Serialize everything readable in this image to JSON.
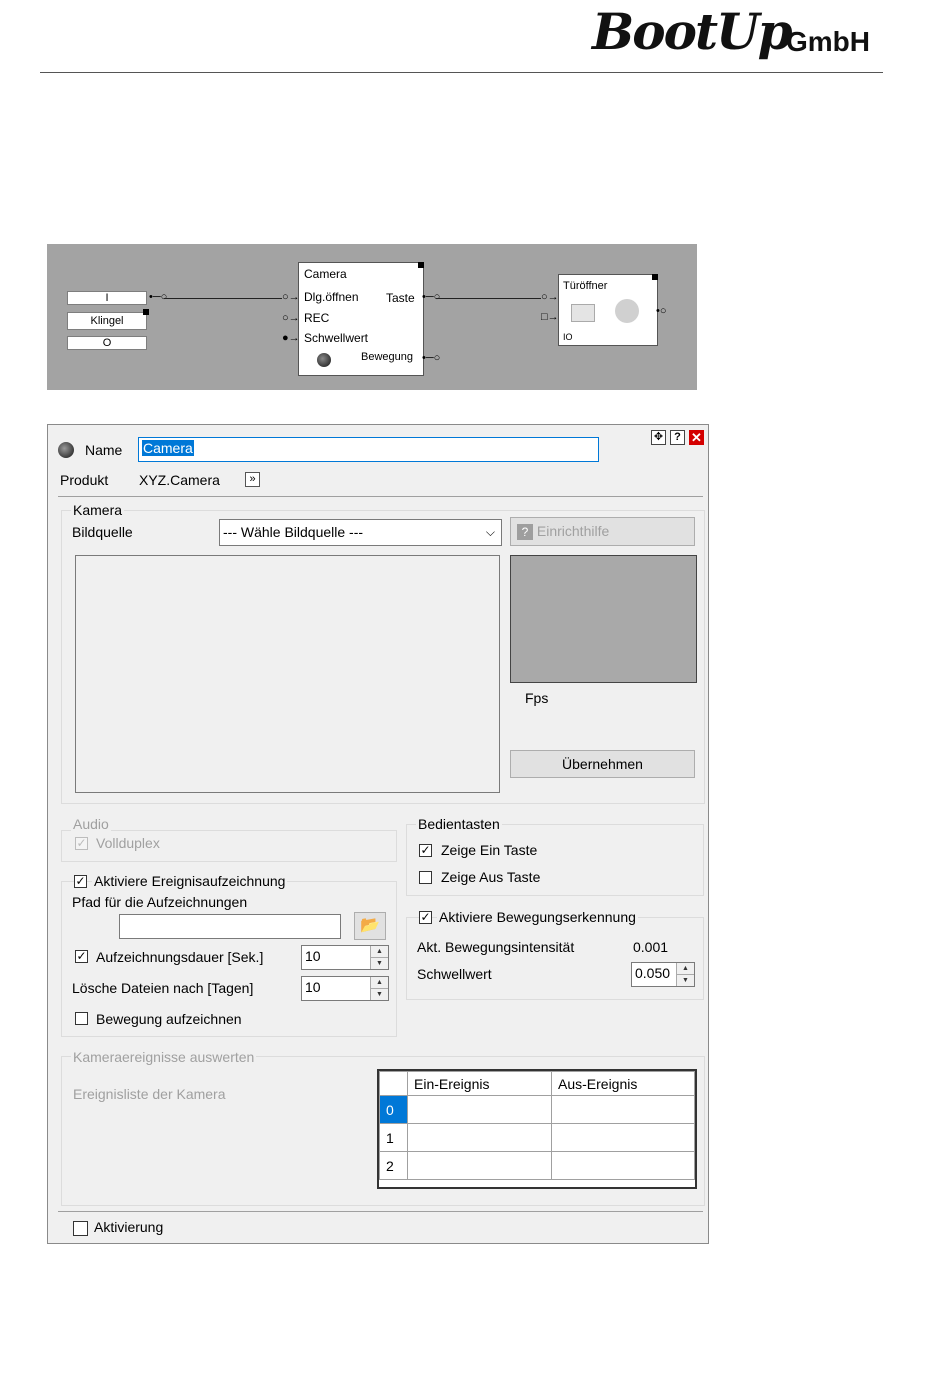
{
  "header": {
    "logo": "BootUp",
    "logo_suffix": "GmbH"
  },
  "diagram": {
    "input_top": "I",
    "input_label": "Klingel",
    "input_bottom": "O",
    "camera_block": {
      "title": "Camera",
      "inputs": [
        "Dlg.öffnen",
        "REC",
        "Schwellwert"
      ],
      "outputs": [
        "Taste",
        "Bewegung"
      ]
    },
    "door_block": {
      "title": "Türöffner",
      "footer": "IO"
    }
  },
  "dialog": {
    "window_icons": [
      "move-icon",
      "help-icon",
      "close-icon"
    ],
    "name_label": "Name",
    "name_value": "Camera",
    "product_label": "Produkt",
    "product_value": "XYZ.Camera",
    "product_button": "»",
    "kamera": {
      "title": "Kamera",
      "bildquelle_label": "Bildquelle",
      "bildquelle_value": "--- Wähle Bildquelle ---",
      "setup_button": "Einrichthilfe",
      "fps_label": "Fps",
      "apply_button": "Übernehmen"
    },
    "audio": {
      "title": "Audio",
      "vollduplex_label": "Vollduplex",
      "vollduplex_checked": true
    },
    "bedientasten": {
      "title": "Bedientasten",
      "zeige_ein_label": "Zeige Ein Taste",
      "zeige_ein_checked": true,
      "zeige_aus_label": "Zeige Aus Taste",
      "zeige_aus_checked": false
    },
    "ereignis": {
      "title": "Aktiviere Ereignisaufzeichnung",
      "checked": true,
      "pfad_label": "Pfad für die Aufzeichnungen",
      "pfad_value": "",
      "dauer_label": "Aufzeichnungsdauer [Sek.]",
      "dauer_checked": true,
      "dauer_value": "10",
      "loesche_label": "Lösche Dateien nach [Tagen]",
      "loesche_value": "10",
      "bewegung_label": "Bewegung aufzeichnen",
      "bewegung_checked": false
    },
    "bewegung": {
      "title": "Aktiviere Bewegungserkennung",
      "checked": true,
      "intensitaet_label": "Akt. Bewegungsintensität",
      "intensitaet_value": "0.001",
      "schwellwert_label": "Schwellwert",
      "schwellwert_value": "0.050"
    },
    "kameraereignisse": {
      "title": "Kameraereignisse auswerten",
      "liste_label": "Ereignisliste der Kamera",
      "columns": [
        "Ein-Ereignis",
        "Aus-Ereignis"
      ],
      "rows": [
        {
          "index": "0",
          "ein": "",
          "aus": ""
        },
        {
          "index": "1",
          "ein": "",
          "aus": ""
        },
        {
          "index": "2",
          "ein": "",
          "aus": ""
        }
      ]
    },
    "aktivierung_label": "Aktivierung",
    "aktivierung_checked": false
  },
  "colors": {
    "selection": "#0078d7",
    "diagram_bg": "#a3a3a3",
    "dialog_bg": "#f0f0f0"
  }
}
